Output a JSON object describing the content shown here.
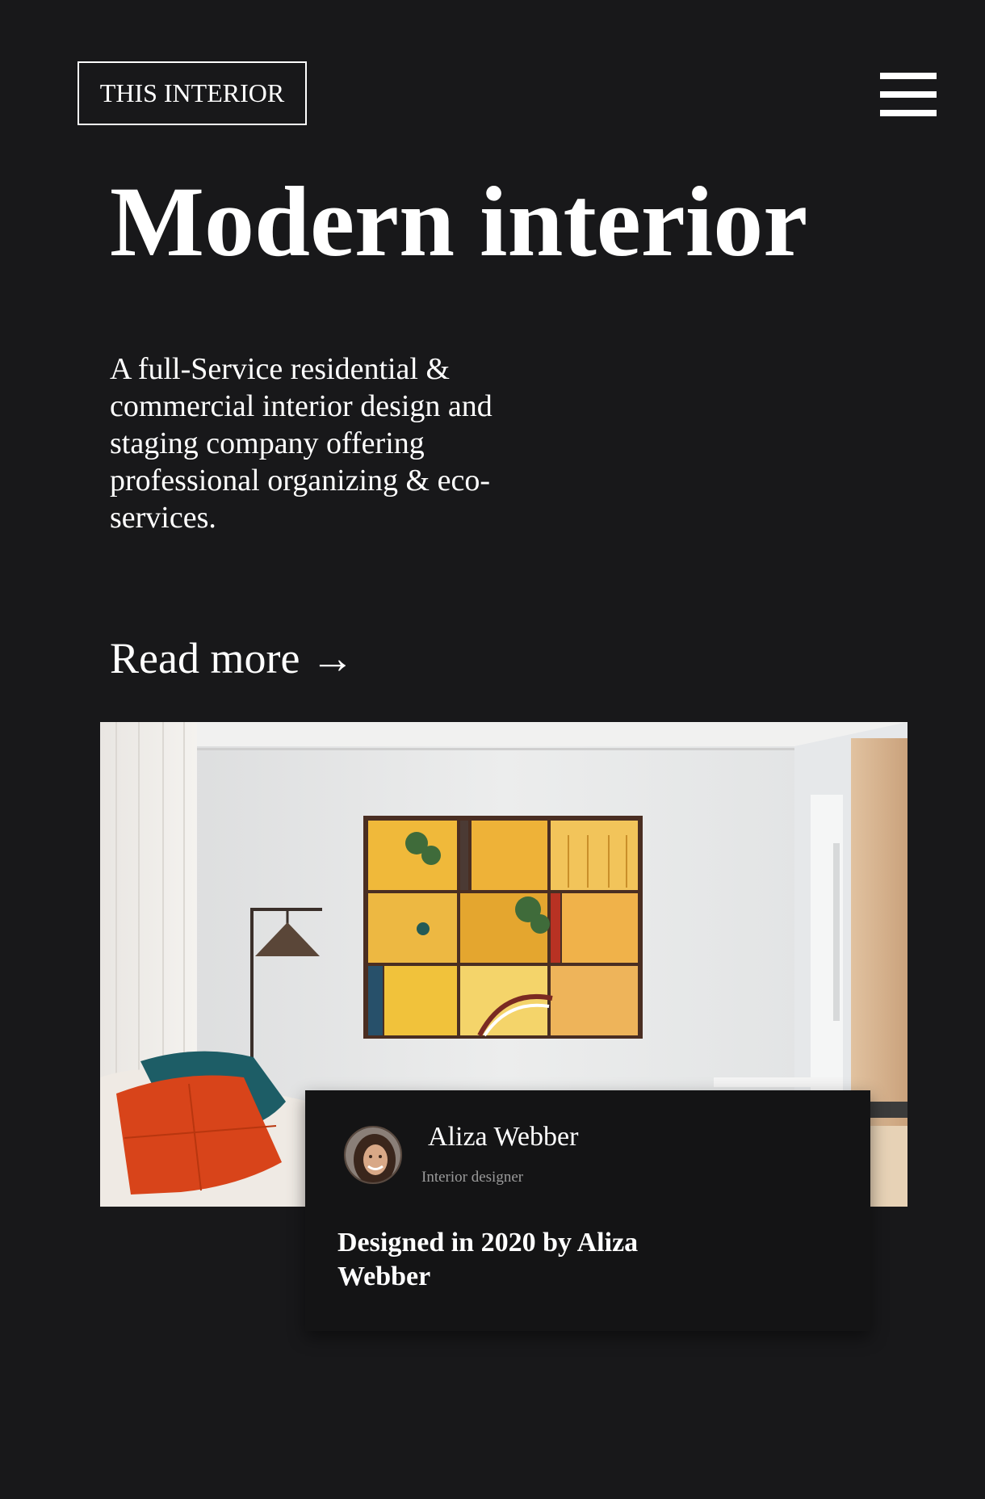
{
  "header": {
    "logo_text": "THIS INTERIOR",
    "menu_icon": "hamburger-menu-icon"
  },
  "hero": {
    "title": "Modern interior",
    "description": "A full-Service residential & commercial interior design and staging company offering professional organizing & eco-services.",
    "read_more_label": "Read more →"
  },
  "feature": {
    "image": "living-room-with-yellow-wall-art",
    "author_name": "Aliza Webber",
    "author_role": "Interior designer",
    "caption": "Designed in 2020 by Aliza Webber"
  },
  "colors": {
    "background": "#18181a",
    "card_background": "#141415",
    "text": "#ffffff",
    "muted_text": "#9a9a9a",
    "art_yellow": "#f0b93a",
    "pillow_orange": "#d8441a",
    "pillow_teal": "#1d5d66"
  }
}
